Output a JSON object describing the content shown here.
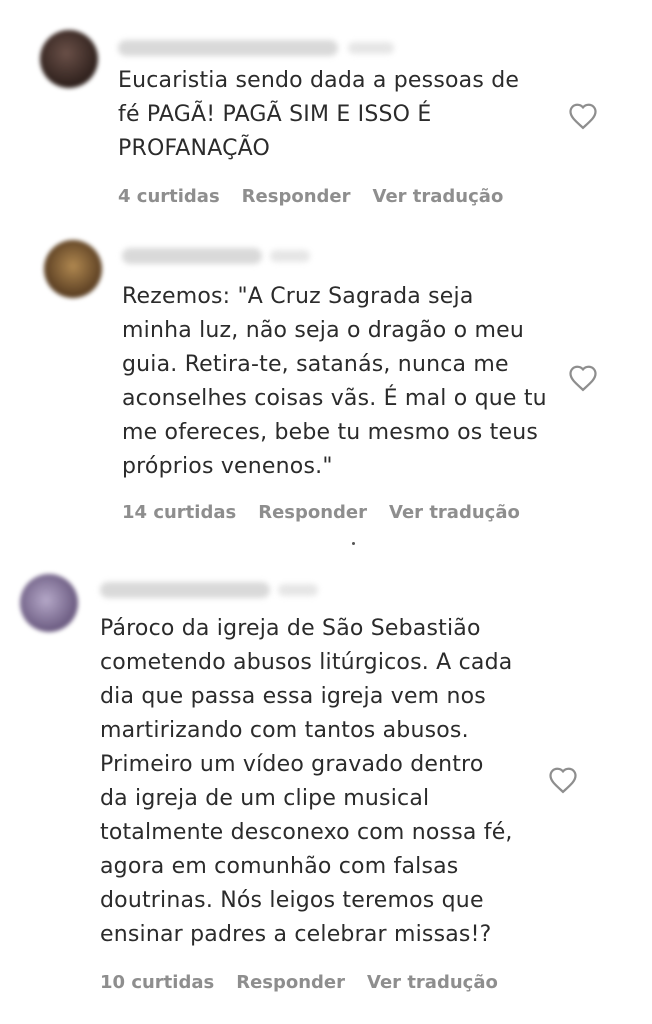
{
  "comments": [
    {
      "text": "Eucaristia sendo dada a pessoas de\nfé PAGÃ! PAGÃ SIM E ISSO É\nPROFANAÇÃO",
      "likes": "4 curtidas",
      "reply": "Responder",
      "translate": "Ver tradução",
      "avatar_color": "#3a2a26"
    },
    {
      "text": "Rezemos: \"A Cruz Sagrada seja\nminha luz, não seja o dragão o meu\nguia. Retira-te, satanás, nunca me\naconselhes coisas vãs. É mal o que tu\nme ofereces, bebe tu mesmo os teus\npróprios venenos.\"",
      "likes": "14 curtidas",
      "reply": "Responder",
      "translate": "Ver tradução",
      "avatar_color": "#6b4a2a"
    },
    {
      "text": "Pároco da igreja de São Sebastião\ncometendo abusos litúrgicos. A cada\ndia que passa essa igreja vem nos\nmartirizando com tantos abusos.\nPrimeiro um vídeo gravado dentro\nda igreja de um clipe musical\ntotalmente desconexo com nossa fé,\nagora em comunhão com falsas\ndoutrinas. Nós leigos teremos que\nensinar padres a celebrar missas!?",
      "likes": "10 curtidas",
      "reply": "Responder",
      "translate": "Ver tradução",
      "avatar_color": "#7a6a8a"
    }
  ],
  "colors": {
    "text": "#2b2b2b",
    "meta": "#8e8e8e",
    "heart": "#8e8e8e"
  },
  "icons": {
    "like": "heart-outline-icon"
  }
}
